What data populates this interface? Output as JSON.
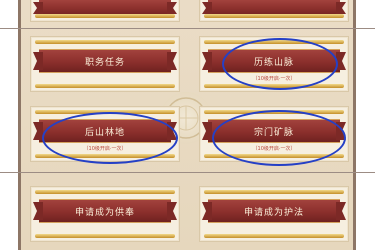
{
  "cards": [
    {
      "id": "top-left-partial",
      "label": "",
      "note": ""
    },
    {
      "id": "top-right-partial",
      "label": "",
      "note": ""
    },
    {
      "id": "duty-task",
      "label": "职务任务",
      "note": ""
    },
    {
      "id": "mountain-vein",
      "label": "历练山脉",
      "note": "（10级开启·一次）"
    },
    {
      "id": "back-mountain-forest",
      "label": "后山林地",
      "note": "（10级开启·一次）"
    },
    {
      "id": "sect-mine",
      "label": "宗门矿脉",
      "note": "（10级开启·一次）"
    },
    {
      "id": "apply-offering",
      "label": "申请成为供奉",
      "note": ""
    },
    {
      "id": "apply-protector",
      "label": "申请成为护法",
      "note": ""
    }
  ],
  "colors": {
    "banner": "#8b2f2c",
    "highlight_ellipse": "#2540c6",
    "panel": "#e6d7bd",
    "note_text": "#b8463c"
  },
  "icons": [
    "gold-scroll-ornament-icon",
    "center-emblem-icon"
  ]
}
